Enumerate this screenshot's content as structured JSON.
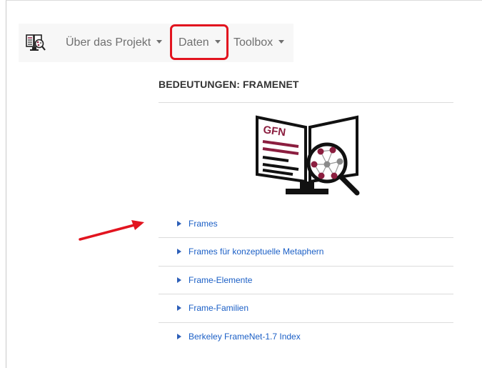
{
  "nav": {
    "items": [
      {
        "label": "Über das Projekt"
      },
      {
        "label": "Daten"
      },
      {
        "label": "Toolbox"
      }
    ]
  },
  "section": {
    "title": "BEDEUTUNGEN: FRAMENET"
  },
  "logo": {
    "text": "GFN"
  },
  "list": [
    {
      "label": "Frames"
    },
    {
      "label": "Frames für konzeptuelle Metaphern"
    },
    {
      "label": "Frame-Elemente"
    },
    {
      "label": "Frame-Familien"
    },
    {
      "label": "Berkeley FrameNet-1.7 Index"
    }
  ],
  "colors": {
    "highlight": "#e2141f",
    "link": "#1b5fc6",
    "logo_accent": "#8b1e3f"
  }
}
